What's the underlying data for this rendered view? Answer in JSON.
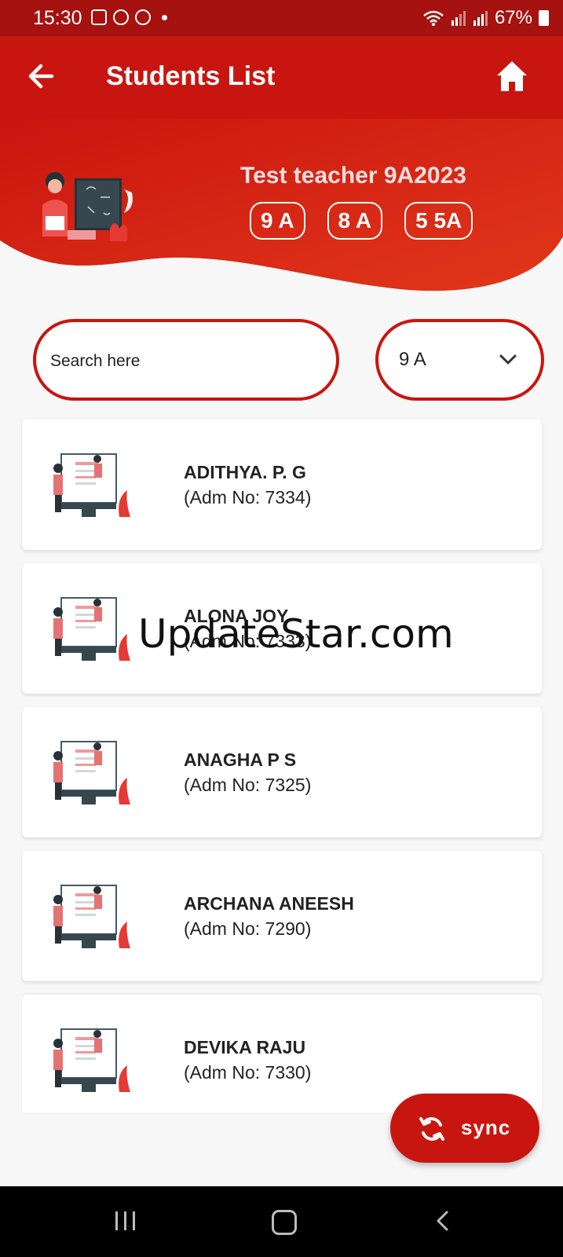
{
  "status_bar": {
    "time": "15:30",
    "battery": "67%",
    "icons": [
      "gallery-icon",
      "whatsapp-icon",
      "whatsapp-icon",
      "wifi-icon",
      "signal-icon",
      "signal-icon",
      "battery-icon"
    ]
  },
  "appbar": {
    "title": "Students List",
    "back_icon": "arrow-left-icon",
    "home_icon": "home-icon"
  },
  "header": {
    "teacher_name": "Test teacher 9A2023",
    "classes": [
      "9 A",
      "8 A",
      "5 5A"
    ]
  },
  "search": {
    "placeholder": "Search here",
    "value": ""
  },
  "class_select": {
    "selected": "9 A"
  },
  "students": [
    {
      "name": "ADITHYA. P. G",
      "adm": "(Adm No: 7334)"
    },
    {
      "name": "ALONA JOY",
      "adm": "(Adm No: 7333)"
    },
    {
      "name": "ANAGHA P S",
      "adm": "(Adm No: 7325)"
    },
    {
      "name": "ARCHANA ANEESH",
      "adm": "(Adm No: 7290)"
    },
    {
      "name": "DEVIKA RAJU",
      "adm": "(Adm No: 7330)"
    }
  ],
  "fab": {
    "label": "sync",
    "icon": "sync-icon"
  },
  "watermark": "UpdateStar.com",
  "colors": {
    "primary": "#c9150f",
    "statusbar": "#a51210",
    "background": "#f7f7f7"
  }
}
